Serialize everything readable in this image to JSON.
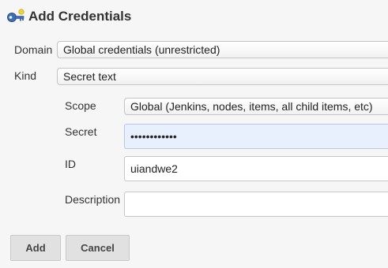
{
  "header": {
    "title": "Add Credentials",
    "icon": "key-icon"
  },
  "form": {
    "domain": {
      "label": "Domain",
      "value": "Global credentials (unrestricted)"
    },
    "kind": {
      "label": "Kind",
      "value": "Secret text"
    },
    "scope": {
      "label": "Scope",
      "value": "Global (Jenkins, nodes, items, all child items, etc)"
    },
    "secret": {
      "label": "Secret",
      "value": "••••••••••••"
    },
    "id": {
      "label": "ID",
      "value": "uiandwe2"
    },
    "description": {
      "label": "Description",
      "value": ""
    }
  },
  "buttons": {
    "add": "Add",
    "cancel": "Cancel"
  },
  "colors": {
    "secret_field_bg": "#e8f0fe",
    "button_bg": "#e1e1e1"
  }
}
